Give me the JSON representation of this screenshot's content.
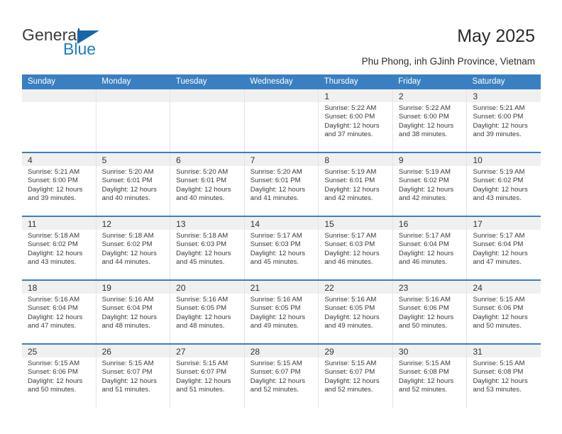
{
  "logo": {
    "line1": "General",
    "line2": "Blue",
    "triangle_icon": "triangle-icon",
    "colors": {
      "blue": "#1a7fc1",
      "triangle": "#1565a8",
      "dark": "#3b3b3b"
    }
  },
  "header": {
    "title": "May 2025",
    "subtitle": "Phu Phong, inh GJinh Province, Vietnam"
  },
  "theme": {
    "header_blue": "#3a7fc1",
    "band_gray": "#f0f0f0",
    "divider_gray": "#e3e3e3"
  },
  "weekdays": [
    "Sunday",
    "Monday",
    "Tuesday",
    "Wednesday",
    "Thursday",
    "Friday",
    "Saturday"
  ],
  "labels": {
    "sunrise": "Sunrise:",
    "sunset": "Sunset:",
    "daylight": "Daylight:"
  },
  "weeks": [
    [
      {
        "day": ""
      },
      {
        "day": ""
      },
      {
        "day": ""
      },
      {
        "day": ""
      },
      {
        "day": "1",
        "sunrise": "Sunrise: 5:22 AM",
        "sunset": "Sunset: 6:00 PM",
        "daylight1": "Daylight: 12 hours",
        "daylight2": "and 37 minutes."
      },
      {
        "day": "2",
        "sunrise": "Sunrise: 5:22 AM",
        "sunset": "Sunset: 6:00 PM",
        "daylight1": "Daylight: 12 hours",
        "daylight2": "and 38 minutes."
      },
      {
        "day": "3",
        "sunrise": "Sunrise: 5:21 AM",
        "sunset": "Sunset: 6:00 PM",
        "daylight1": "Daylight: 12 hours",
        "daylight2": "and 39 minutes."
      }
    ],
    [
      {
        "day": "4",
        "sunrise": "Sunrise: 5:21 AM",
        "sunset": "Sunset: 6:00 PM",
        "daylight1": "Daylight: 12 hours",
        "daylight2": "and 39 minutes."
      },
      {
        "day": "5",
        "sunrise": "Sunrise: 5:20 AM",
        "sunset": "Sunset: 6:01 PM",
        "daylight1": "Daylight: 12 hours",
        "daylight2": "and 40 minutes."
      },
      {
        "day": "6",
        "sunrise": "Sunrise: 5:20 AM",
        "sunset": "Sunset: 6:01 PM",
        "daylight1": "Daylight: 12 hours",
        "daylight2": "and 40 minutes."
      },
      {
        "day": "7",
        "sunrise": "Sunrise: 5:20 AM",
        "sunset": "Sunset: 6:01 PM",
        "daylight1": "Daylight: 12 hours",
        "daylight2": "and 41 minutes."
      },
      {
        "day": "8",
        "sunrise": "Sunrise: 5:19 AM",
        "sunset": "Sunset: 6:01 PM",
        "daylight1": "Daylight: 12 hours",
        "daylight2": "and 42 minutes."
      },
      {
        "day": "9",
        "sunrise": "Sunrise: 5:19 AM",
        "sunset": "Sunset: 6:02 PM",
        "daylight1": "Daylight: 12 hours",
        "daylight2": "and 42 minutes."
      },
      {
        "day": "10",
        "sunrise": "Sunrise: 5:19 AM",
        "sunset": "Sunset: 6:02 PM",
        "daylight1": "Daylight: 12 hours",
        "daylight2": "and 43 minutes."
      }
    ],
    [
      {
        "day": "11",
        "sunrise": "Sunrise: 5:18 AM",
        "sunset": "Sunset: 6:02 PM",
        "daylight1": "Daylight: 12 hours",
        "daylight2": "and 43 minutes."
      },
      {
        "day": "12",
        "sunrise": "Sunrise: 5:18 AM",
        "sunset": "Sunset: 6:02 PM",
        "daylight1": "Daylight: 12 hours",
        "daylight2": "and 44 minutes."
      },
      {
        "day": "13",
        "sunrise": "Sunrise: 5:18 AM",
        "sunset": "Sunset: 6:03 PM",
        "daylight1": "Daylight: 12 hours",
        "daylight2": "and 45 minutes."
      },
      {
        "day": "14",
        "sunrise": "Sunrise: 5:17 AM",
        "sunset": "Sunset: 6:03 PM",
        "daylight1": "Daylight: 12 hours",
        "daylight2": "and 45 minutes."
      },
      {
        "day": "15",
        "sunrise": "Sunrise: 5:17 AM",
        "sunset": "Sunset: 6:03 PM",
        "daylight1": "Daylight: 12 hours",
        "daylight2": "and 46 minutes."
      },
      {
        "day": "16",
        "sunrise": "Sunrise: 5:17 AM",
        "sunset": "Sunset: 6:04 PM",
        "daylight1": "Daylight: 12 hours",
        "daylight2": "and 46 minutes."
      },
      {
        "day": "17",
        "sunrise": "Sunrise: 5:17 AM",
        "sunset": "Sunset: 6:04 PM",
        "daylight1": "Daylight: 12 hours",
        "daylight2": "and 47 minutes."
      }
    ],
    [
      {
        "day": "18",
        "sunrise": "Sunrise: 5:16 AM",
        "sunset": "Sunset: 6:04 PM",
        "daylight1": "Daylight: 12 hours",
        "daylight2": "and 47 minutes."
      },
      {
        "day": "19",
        "sunrise": "Sunrise: 5:16 AM",
        "sunset": "Sunset: 6:04 PM",
        "daylight1": "Daylight: 12 hours",
        "daylight2": "and 48 minutes."
      },
      {
        "day": "20",
        "sunrise": "Sunrise: 5:16 AM",
        "sunset": "Sunset: 6:05 PM",
        "daylight1": "Daylight: 12 hours",
        "daylight2": "and 48 minutes."
      },
      {
        "day": "21",
        "sunrise": "Sunrise: 5:16 AM",
        "sunset": "Sunset: 6:05 PM",
        "daylight1": "Daylight: 12 hours",
        "daylight2": "and 49 minutes."
      },
      {
        "day": "22",
        "sunrise": "Sunrise: 5:16 AM",
        "sunset": "Sunset: 6:05 PM",
        "daylight1": "Daylight: 12 hours",
        "daylight2": "and 49 minutes."
      },
      {
        "day": "23",
        "sunrise": "Sunrise: 5:16 AM",
        "sunset": "Sunset: 6:06 PM",
        "daylight1": "Daylight: 12 hours",
        "daylight2": "and 50 minutes."
      },
      {
        "day": "24",
        "sunrise": "Sunrise: 5:15 AM",
        "sunset": "Sunset: 6:06 PM",
        "daylight1": "Daylight: 12 hours",
        "daylight2": "and 50 minutes."
      }
    ],
    [
      {
        "day": "25",
        "sunrise": "Sunrise: 5:15 AM",
        "sunset": "Sunset: 6:06 PM",
        "daylight1": "Daylight: 12 hours",
        "daylight2": "and 50 minutes."
      },
      {
        "day": "26",
        "sunrise": "Sunrise: 5:15 AM",
        "sunset": "Sunset: 6:07 PM",
        "daylight1": "Daylight: 12 hours",
        "daylight2": "and 51 minutes."
      },
      {
        "day": "27",
        "sunrise": "Sunrise: 5:15 AM",
        "sunset": "Sunset: 6:07 PM",
        "daylight1": "Daylight: 12 hours",
        "daylight2": "and 51 minutes."
      },
      {
        "day": "28",
        "sunrise": "Sunrise: 5:15 AM",
        "sunset": "Sunset: 6:07 PM",
        "daylight1": "Daylight: 12 hours",
        "daylight2": "and 52 minutes."
      },
      {
        "day": "29",
        "sunrise": "Sunrise: 5:15 AM",
        "sunset": "Sunset: 6:07 PM",
        "daylight1": "Daylight: 12 hours",
        "daylight2": "and 52 minutes."
      },
      {
        "day": "30",
        "sunrise": "Sunrise: 5:15 AM",
        "sunset": "Sunset: 6:08 PM",
        "daylight1": "Daylight: 12 hours",
        "daylight2": "and 52 minutes."
      },
      {
        "day": "31",
        "sunrise": "Sunrise: 5:15 AM",
        "sunset": "Sunset: 6:08 PM",
        "daylight1": "Daylight: 12 hours",
        "daylight2": "and 53 minutes."
      }
    ]
  ]
}
